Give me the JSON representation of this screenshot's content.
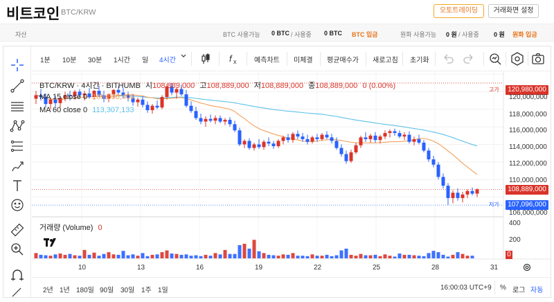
{
  "header": {
    "coin_name": "비트코인",
    "pair": "BTC/KRW",
    "auto_trade_button": "오토트레이딩",
    "screen_settings_button": "거래화면 설정"
  },
  "assets": {
    "label": "자산",
    "btc_available_label": "BTC 사용가능",
    "btc_available_value": "0 BTC",
    "btc_in_use_label": "/ 사용중",
    "btc_in_use_value": "0 BTC",
    "btc_deposit": "BTC 입금",
    "krw_available_label": "원화 사용가능",
    "krw_available_value": "0 원",
    "krw_in_use_label": "/ 사용중",
    "krw_in_use_value": "0 원",
    "krw_deposit": "원화 입금"
  },
  "toolbar": {
    "intervals": [
      "1분",
      "10분",
      "30분",
      "1시간",
      "일",
      "4시간"
    ],
    "active_interval": "4시간",
    "fx_label": "fx",
    "prediction_chart": "예측차트",
    "filled": "미체결",
    "avg_buy_price": "평균매수가",
    "refresh": "새로고침",
    "reset": "초기화"
  },
  "legend": {
    "title": "BTC/KRW · 4시간 · BITHUMB",
    "open_label": "시",
    "open": "108,889,000",
    "high_label": "고",
    "high": "108,889,000",
    "low_label": "저",
    "low": "108,889,000",
    "close_label": "종",
    "close": "108,889,000",
    "change": "0 (0.00%)",
    "ma15_label": "MA 15 close 0",
    "ma15_value": "109,636,400",
    "ma60_label": "MA 60 close 0",
    "ma60_value": "113,307,133",
    "volume_label": "거래량 (Volume)",
    "volume_value": "0"
  },
  "price_markers": {
    "high_tag": "고가",
    "high_value": "120,980,000",
    "current_value": "108,889,000",
    "low_tag": "저가",
    "low_value": "107,096,000"
  },
  "chart_data": {
    "type": "candlestick",
    "title": "BTC/KRW · 4시간 · BITHUMB",
    "y_axis_ticks": [
      "122,000,000",
      "120,000,000",
      "118,000,000",
      "116,000,000",
      "114,000,000",
      "112,000,000",
      "110,000,000",
      "108,000,000",
      "106,000,000"
    ],
    "ylim": [
      106000000,
      122000000
    ],
    "x_axis_ticks": [
      "10",
      "13",
      "16",
      "19",
      "22",
      "25",
      "28",
      "31"
    ],
    "volume_axis_ticks": [
      "400",
      "200",
      "0"
    ],
    "volume_ylim": [
      0,
      400
    ],
    "series": [
      {
        "name": "MA 15 close 0",
        "last": 109636400,
        "color": "#f5a05a"
      },
      {
        "name": "MA 60 close 0",
        "last": 113307133,
        "color": "#5bc0e8"
      }
    ],
    "candles_ohlc": [
      [
        119.2,
        120.1,
        118.6,
        119.6
      ],
      [
        119.6,
        120.3,
        119.0,
        119.4
      ],
      [
        119.4,
        119.8,
        118.2,
        118.6
      ],
      [
        118.6,
        119.3,
        118.0,
        119.1
      ],
      [
        119.1,
        119.5,
        118.3,
        118.7
      ],
      [
        118.7,
        119.4,
        118.2,
        119.3
      ],
      [
        119.3,
        120.0,
        118.9,
        119.6
      ],
      [
        119.6,
        120.1,
        119.0,
        119.5
      ],
      [
        119.5,
        120.2,
        119.1,
        120.0
      ],
      [
        120.0,
        120.3,
        119.3,
        119.6
      ],
      [
        119.6,
        120.1,
        119.0,
        119.8
      ],
      [
        119.8,
        120.4,
        119.2,
        119.4
      ],
      [
        119.4,
        120.2,
        119.1,
        120.1
      ],
      [
        120.1,
        120.7,
        119.4,
        119.6
      ],
      [
        119.6,
        120.1,
        118.8,
        119.2
      ],
      [
        119.2,
        119.8,
        118.8,
        119.7
      ],
      [
        119.7,
        120.3,
        119.3,
        120.2
      ],
      [
        120.2,
        120.6,
        119.6,
        119.9
      ],
      [
        119.9,
        120.4,
        119.2,
        119.6
      ],
      [
        119.6,
        120.0,
        118.9,
        119.3
      ],
      [
        119.3,
        119.7,
        118.4,
        118.8
      ],
      [
        118.8,
        119.3,
        118.3,
        119.1
      ],
      [
        119.1,
        119.5,
        118.2,
        118.5
      ],
      [
        118.5,
        118.9,
        117.6,
        117.9
      ],
      [
        117.9,
        118.6,
        117.5,
        118.4
      ],
      [
        118.4,
        119.0,
        118.0,
        118.2
      ],
      [
        118.2,
        119.6,
        118.0,
        119.4
      ],
      [
        119.4,
        120.9,
        119.1,
        120.6
      ],
      [
        120.6,
        120.98,
        119.6,
        119.9
      ],
      [
        119.9,
        120.5,
        119.2,
        120.3
      ],
      [
        120.3,
        120.8,
        119.5,
        119.7
      ],
      [
        119.7,
        120.2,
        118.2,
        118.4
      ],
      [
        118.4,
        118.9,
        117.6,
        117.8
      ],
      [
        117.8,
        118.3,
        116.8,
        117.0
      ],
      [
        117.0,
        117.5,
        116.3,
        116.6
      ],
      [
        116.6,
        117.2,
        116.0,
        116.9
      ],
      [
        116.9,
        117.4,
        116.5,
        116.7
      ],
      [
        116.7,
        117.3,
        116.3,
        117.0
      ],
      [
        117.0,
        117.3,
        116.4,
        116.6
      ],
      [
        116.6,
        117.0,
        116.2,
        116.8
      ],
      [
        116.8,
        117.1,
        116.0,
        116.3
      ],
      [
        116.3,
        116.7,
        115.4,
        115.6
      ],
      [
        115.6,
        115.9,
        113.8,
        114.0
      ],
      [
        114.0,
        114.6,
        113.6,
        114.4
      ],
      [
        114.4,
        114.7,
        113.4,
        113.6
      ],
      [
        113.6,
        114.2,
        113.3,
        114.0
      ],
      [
        114.0,
        114.6,
        113.5,
        113.7
      ],
      [
        113.7,
        114.5,
        113.4,
        114.3
      ],
      [
        114.3,
        114.8,
        113.8,
        114.1
      ],
      [
        114.1,
        114.4,
        113.5,
        113.8
      ],
      [
        113.8,
        114.6,
        113.6,
        114.4
      ],
      [
        114.4,
        115.0,
        114.0,
        114.8
      ],
      [
        114.8,
        115.2,
        114.2,
        114.5
      ],
      [
        114.5,
        115.4,
        114.2,
        115.2
      ],
      [
        115.2,
        115.6,
        114.6,
        114.9
      ],
      [
        114.9,
        115.3,
        114.3,
        114.6
      ],
      [
        114.6,
        115.1,
        114.0,
        114.3
      ],
      [
        114.3,
        115.0,
        114.1,
        114.8
      ],
      [
        114.8,
        115.2,
        114.3,
        114.6
      ],
      [
        114.6,
        115.3,
        114.4,
        115.1
      ],
      [
        115.1,
        115.5,
        114.6,
        114.8
      ],
      [
        114.8,
        115.2,
        114.1,
        114.4
      ],
      [
        114.4,
        114.8,
        113.4,
        113.6
      ],
      [
        113.6,
        114.0,
        112.6,
        112.9
      ],
      [
        112.9,
        113.3,
        111.8,
        112.1
      ],
      [
        112.1,
        113.4,
        111.9,
        113.1
      ],
      [
        113.1,
        114.2,
        112.9,
        113.9
      ],
      [
        113.9,
        115.0,
        113.6,
        114.8
      ],
      [
        114.8,
        115.4,
        114.3,
        114.6
      ],
      [
        114.6,
        115.2,
        114.2,
        115.0
      ],
      [
        115.0,
        115.4,
        114.2,
        114.5
      ],
      [
        114.5,
        115.1,
        114.1,
        114.9
      ],
      [
        114.9,
        115.6,
        114.6,
        115.3
      ],
      [
        115.3,
        115.7,
        114.8,
        115.5
      ],
      [
        115.5,
        115.8,
        115.0,
        115.3
      ],
      [
        115.3,
        115.6,
        114.7,
        114.9
      ],
      [
        114.9,
        115.4,
        114.5,
        115.1
      ],
      [
        115.1,
        115.5,
        114.1,
        114.3
      ],
      [
        114.3,
        114.9,
        113.9,
        114.6
      ],
      [
        114.6,
        115.1,
        114.0,
        114.2
      ],
      [
        114.2,
        114.5,
        113.1,
        113.3
      ],
      [
        113.3,
        113.6,
        112.0,
        112.3
      ],
      [
        112.3,
        112.7,
        111.4,
        111.7
      ],
      [
        111.7,
        112.0,
        110.0,
        110.3
      ],
      [
        110.3,
        110.7,
        109.0,
        109.3
      ],
      [
        109.3,
        109.6,
        107.1,
        107.9
      ],
      [
        107.9,
        108.8,
        107.3,
        108.5
      ],
      [
        108.5,
        109.0,
        107.6,
        107.9
      ],
      [
        107.9,
        108.6,
        107.4,
        108.3
      ],
      [
        108.3,
        108.9,
        107.9,
        108.7
      ],
      [
        108.7,
        109.1,
        108.2,
        108.4
      ],
      [
        108.4,
        109.0,
        108.0,
        108.889
      ]
    ],
    "volumes": [
      60,
      40,
      35,
      30,
      45,
      55,
      40,
      50,
      35,
      30,
      95,
      40,
      65,
      30,
      50,
      70,
      45,
      40,
      85,
      35,
      45,
      30,
      60,
      25,
      40,
      45,
      70,
      90,
      55,
      50,
      40,
      45,
      30,
      35,
      25,
      40,
      30,
      60,
      45,
      95,
      50,
      50,
      150,
      165,
      110,
      210,
      80,
      60,
      40,
      35,
      30,
      45,
      40,
      60,
      30,
      30,
      25,
      45,
      30,
      30,
      40,
      25,
      35,
      90,
      110,
      40,
      30,
      50,
      35,
      35,
      40,
      25,
      45,
      30,
      20,
      55,
      40,
      40,
      35,
      30,
      25,
      60,
      85,
      70,
      40,
      20,
      40,
      70,
      50,
      30,
      30
    ]
  }
}
